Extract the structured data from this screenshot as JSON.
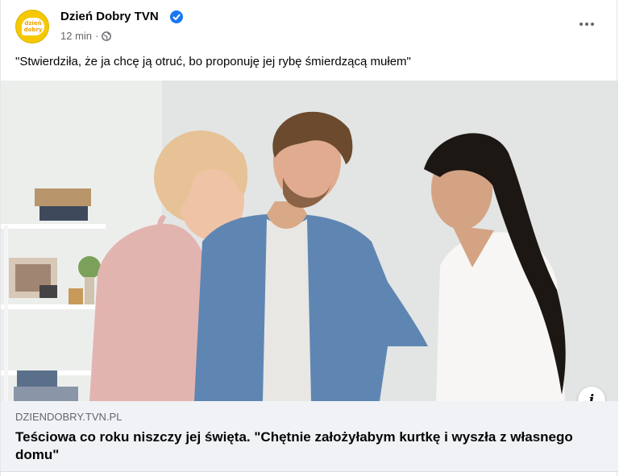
{
  "post": {
    "page_name": "Dzień Dobry TVN",
    "avatar_text_line1": "dzień",
    "avatar_text_line2": "dobry",
    "time": "12 min",
    "separator": "·",
    "privacy_icon": "globe-icon",
    "more_icon": "more-options-icon",
    "verified_icon": "verified-badge-icon",
    "text": "\"Stwierdziła, że ja chcę ją otruć, bo proponuję jej rybę śmierdzącą mułem\""
  },
  "link": {
    "domain": "DZIENDOBRY.TVN.PL",
    "headline": "Teściowa co roku niszczy jej święta. \"Chętnie założyłabym kurtkę i wyszła z własnego domu\"",
    "info_label": "i"
  },
  "colors": {
    "verified": "#1877f2",
    "avatar_bg": "#f5c800",
    "link_box_bg": "#f0f2f5",
    "secondary_text": "#65676b"
  }
}
